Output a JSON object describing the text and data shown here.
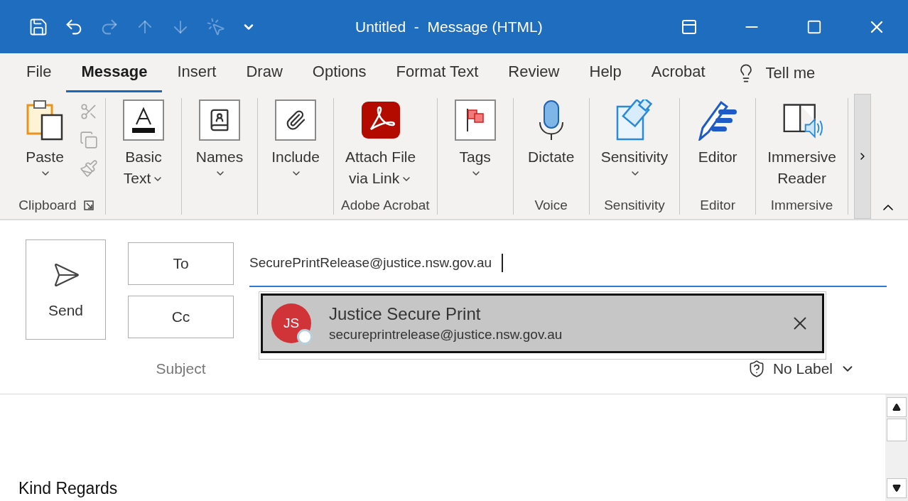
{
  "title_bar": {
    "title": "Untitled  -  Message (HTML)",
    "quick_access": [
      {
        "kind": "save",
        "disabled": false
      },
      {
        "kind": "undo",
        "disabled": false
      },
      {
        "kind": "redo",
        "disabled": true
      },
      {
        "kind": "up",
        "disabled": true
      },
      {
        "kind": "down",
        "disabled": true
      },
      {
        "kind": "touch",
        "disabled": true
      },
      {
        "kind": "customize",
        "disabled": false
      }
    ]
  },
  "menu_tabs": [
    {
      "label": "File",
      "selected": false
    },
    {
      "label": "Message",
      "selected": true
    },
    {
      "label": "Insert",
      "selected": false
    },
    {
      "label": "Draw",
      "selected": false
    },
    {
      "label": "Options",
      "selected": false
    },
    {
      "label": "Format Text",
      "selected": false
    },
    {
      "label": "Review",
      "selected": false
    },
    {
      "label": "Help",
      "selected": false
    },
    {
      "label": "Acrobat",
      "selected": false
    }
  ],
  "tell_me": "Tell me",
  "ribbon": {
    "groups": [
      {
        "label": "Clipboard",
        "launcher": true,
        "buttons": [
          {
            "kind": "paste",
            "lines": [
              "Paste"
            ],
            "dropdown": true
          }
        ],
        "small_tools": [
          {
            "kind": "cut",
            "disabled": true
          },
          {
            "kind": "copy",
            "disabled": true
          },
          {
            "kind": "painter",
            "disabled": true
          }
        ]
      },
      {
        "buttons": [
          {
            "kind": "basic-text",
            "lines": [
              "Basic",
              "Text"
            ],
            "dropdown": true
          }
        ]
      },
      {
        "buttons": [
          {
            "kind": "names",
            "lines": [
              "Names"
            ],
            "dropdown": true
          }
        ]
      },
      {
        "buttons": [
          {
            "kind": "include",
            "lines": [
              "Include"
            ],
            "dropdown": true
          }
        ]
      },
      {
        "label": "Adobe Acrobat",
        "buttons": [
          {
            "kind": "acrobat",
            "lines": [
              "Attach File",
              "via Link"
            ],
            "dropdown": true
          }
        ]
      },
      {
        "buttons": [
          {
            "kind": "tags",
            "lines": [
              "Tags"
            ],
            "dropdown": true
          }
        ]
      },
      {
        "label": "Voice",
        "buttons": [
          {
            "kind": "dictate",
            "lines": [
              "Dictate"
            ],
            "dropdown": false
          }
        ]
      },
      {
        "label": "Sensitivity",
        "buttons": [
          {
            "kind": "sensitivity",
            "lines": [
              "Sensitivity"
            ],
            "dropdown": true
          }
        ]
      },
      {
        "label": "Editor",
        "buttons": [
          {
            "kind": "editor",
            "lines": [
              "Editor"
            ],
            "dropdown": false
          }
        ]
      },
      {
        "label": "Immersive",
        "buttons": [
          {
            "kind": "reader",
            "lines": [
              "Immersive",
              "Reader"
            ],
            "dropdown": false
          }
        ]
      }
    ]
  },
  "compose": {
    "send": "Send",
    "to_button": "To",
    "cc_button": "Cc",
    "to_value": "SecurePrintRelease@justice.nsw.gov.au",
    "subject_label": "Subject",
    "sensitivity_label": "No Label",
    "suggestion": {
      "initials": "JS",
      "name": "Justice Secure Print",
      "email": "secureprintrelease@justice.nsw.gov.au",
      "selected": true
    }
  },
  "body": {
    "text": "Kind Regards"
  }
}
